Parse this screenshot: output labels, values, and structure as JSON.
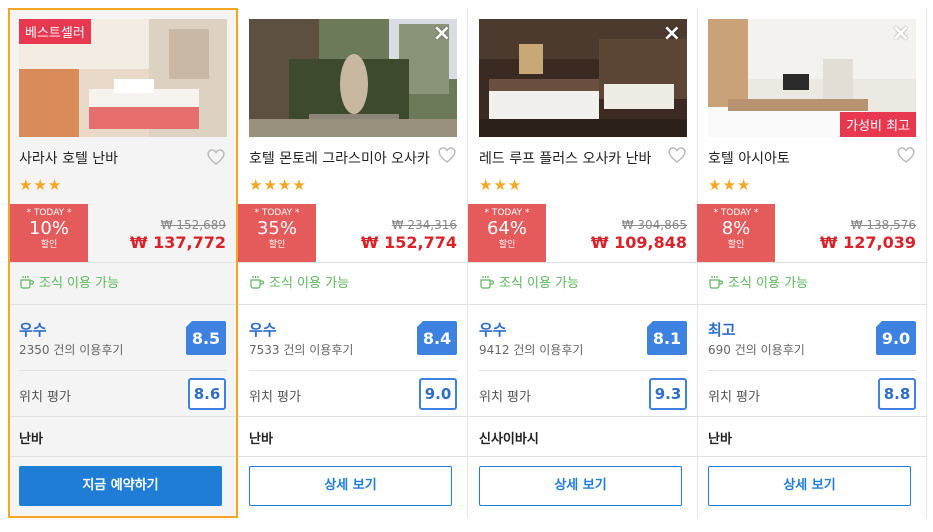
{
  "hotels": [
    {
      "badge": "베스트셀러",
      "name": "사라사 호텔 난바",
      "stars": "★★★",
      "today": "* TODAY *",
      "discount": "10%",
      "sale": "할인",
      "old_price": "₩ 152,689",
      "new_price": "₩ 137,772",
      "breakfast": "조식 이용 가능",
      "rating_word": "우수",
      "reviews": "2350 건의 이용후기",
      "score": "8.5",
      "location_label": "위치 평가",
      "location_score": "8.6",
      "area": "난바",
      "button": "지금 예약하기"
    },
    {
      "name": "호텔 몬토레 그라스미아 오사카",
      "stars": "★★★★",
      "today": "* TODAY *",
      "discount": "35%",
      "sale": "할인",
      "old_price": "₩ 234,316",
      "new_price": "₩ 152,774",
      "breakfast": "조식 이용 가능",
      "rating_word": "우수",
      "reviews": "7533 건의 이용후기",
      "score": "8.4",
      "location_label": "위치 평가",
      "location_score": "9.0",
      "area": "난바",
      "button": "상세 보기"
    },
    {
      "name": "레드 루프 플러스 오사카 난바",
      "stars": "★★★",
      "today": "* TODAY *",
      "discount": "64%",
      "sale": "할인",
      "old_price": "₩ 304,865",
      "new_price": "₩ 109,848",
      "breakfast": "조식 이용 가능",
      "rating_word": "우수",
      "reviews": "9412 건의 이용후기",
      "score": "8.1",
      "location_label": "위치 평가",
      "location_score": "9.3",
      "area": "신사이바시",
      "button": "상세 보기"
    },
    {
      "badge_bottom": "가성비 최고",
      "name": "호텔 아시아토",
      "stars": "★★★",
      "today": "* TODAY *",
      "discount": "8%",
      "sale": "할인",
      "old_price": "₩ 138,576",
      "new_price": "₩ 127,039",
      "breakfast": "조식 이용 가능",
      "rating_word": "최고",
      "reviews": "690 건의 이용후기",
      "score": "9.0",
      "location_label": "위치 평가",
      "location_score": "8.8",
      "area": "난바",
      "button": "상세 보기"
    }
  ],
  "close_icon": "×",
  "colors": {
    "accent": "#1f7dd6",
    "highlight_border": "#f5a623",
    "deal_red": "#e55a5a",
    "price_red": "#d8232a",
    "score_blue": "#3d82e0",
    "breakfast_green": "#5cb85c"
  }
}
